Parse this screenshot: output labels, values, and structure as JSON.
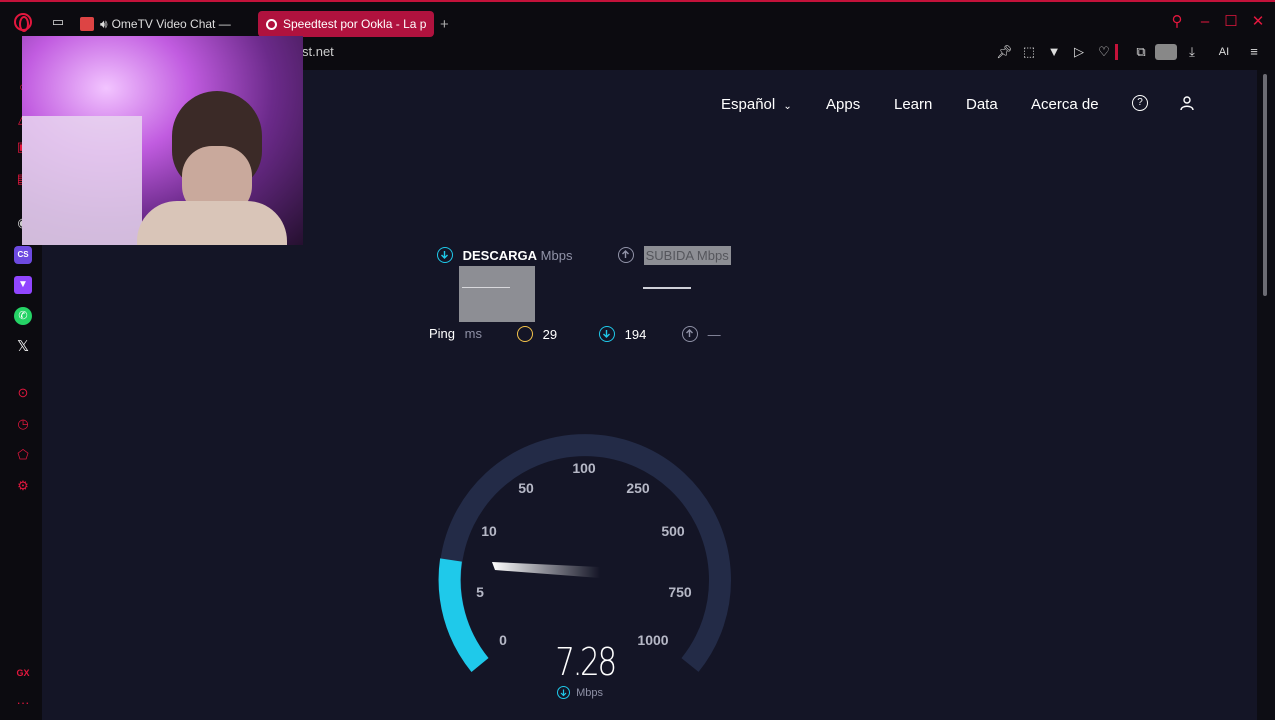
{
  "browser": {
    "tabs": [
      {
        "label": "OmeTV Video Chat — "
      },
      {
        "label": "Speedtest por Ookla - La p"
      }
    ],
    "new_tab": "+",
    "url": "st.net",
    "ai_label": "AI"
  },
  "nav": {
    "language": "Español",
    "apps": "Apps",
    "learn": "Learn",
    "data": "Data",
    "about": "Acerca de"
  },
  "metrics": {
    "download_label": "DESCARGA",
    "download_unit": "Mbps",
    "upload_label": "SUBIDA Mbps",
    "ping_label": "Ping",
    "ping_unit": "ms",
    "ping_value": "29",
    "ping_down": "194",
    "ping_up": "—"
  },
  "gauge": {
    "ticks": [
      "0",
      "5",
      "10",
      "50",
      "100",
      "250",
      "500",
      "750",
      "1000"
    ],
    "current_value": "7.28",
    "unit": "Mbps",
    "accent_color": "#1fc9ea"
  },
  "sidebar": {
    "cs_label": "CS",
    "gx_label": "GX"
  },
  "colors": {
    "brand": "#e3173e",
    "page_bg": "#141526",
    "accent": "#1fc9ea"
  }
}
